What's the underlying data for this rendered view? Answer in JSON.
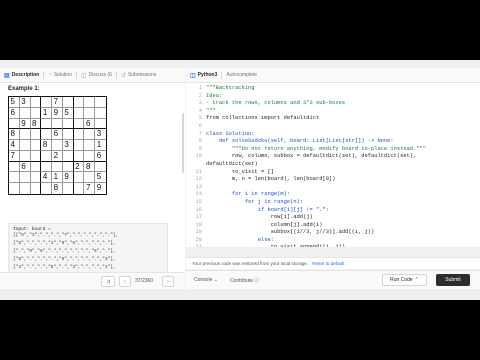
{
  "left_tabs": [
    {
      "icon": "▤",
      "label": "Description",
      "active": true
    },
    {
      "icon": "◔",
      "label": "Solution",
      "active": false
    },
    {
      "icon": "◫",
      "label": "Discuss (6",
      "active": false
    },
    {
      "icon": "↺",
      "label": "Submissions",
      "active": false
    }
  ],
  "right_tabs": [
    {
      "icon": "◫",
      "label": "Python3",
      "active": true
    },
    {
      "icon": "",
      "label": "Autocomplete",
      "active": false
    }
  ],
  "example_title": "Example 1:",
  "board": [
    [
      "5",
      "3",
      "",
      "",
      "7",
      "",
      "",
      "",
      ""
    ],
    [
      "6",
      "",
      "",
      "1",
      "9",
      "5",
      "",
      "",
      ""
    ],
    [
      "",
      "9",
      "8",
      "",
      "",
      "",
      "",
      "6",
      ""
    ],
    [
      "8",
      "",
      "",
      "",
      "6",
      "",
      "",
      "",
      "3"
    ],
    [
      "4",
      "",
      "",
      "8",
      "",
      "3",
      "",
      "",
      "1"
    ],
    [
      "7",
      "",
      "",
      "",
      "2",
      "",
      "",
      "",
      "6"
    ],
    [
      "",
      "6",
      "",
      "",
      "",
      "",
      "2",
      "8",
      ""
    ],
    [
      "",
      "",
      "",
      "4",
      "1",
      "9",
      "",
      "",
      "5"
    ],
    [
      "",
      "",
      "",
      "",
      "8",
      "",
      "",
      "7",
      "9"
    ]
  ],
  "input_label": "Input: board =",
  "input_lines": [
    "[[\"5\",\"3\",\".\",\".\",\"7\",\".\",\".\",\".\",\".\"],",
    "[\"6\",\".\",\".\",\"1\",\"9\",\"5\",\".\",\".\",\".\"],",
    "[\".\",\"9\",\"8\",\".\",\".\",\".\",\".\",\"6\",\".\"],",
    "[\"8\",\".\",\".\",\".\",\"6\",\".\",\".\",\".\",\"3\"],",
    "[\"4\",\".\",\".\",\"8\",\".\",\"3\",\".\",\".\",\"1\"],",
    "[\"7\",\".\",\".\",\".\",\"2\",\".\",\".\",\".\",\"6\"],",
    "[\".\",\"6\",\".\",\".\",\".\",\".\",\"2\",\"8\",\".\"],"
  ],
  "bottom_left": {
    "shuffle_icon": "⤨",
    "prev_icon": "‹",
    "pager": "37/2360",
    "next_icon": "›"
  },
  "code_lines": [
    {
      "n": "1",
      "t": "\"\"\"Backtracking",
      "c": "cm"
    },
    {
      "n": "2",
      "t": "Idea:",
      "c": "cm"
    },
    {
      "n": "3",
      "t": "- track the rows, columns and 3*3 sub-boxes",
      "c": "cm"
    },
    {
      "n": "4",
      "t": "\"\"\"",
      "c": "cm"
    },
    {
      "n": "5",
      "t": "from collections import defaultdict",
      "c": ""
    },
    {
      "n": "6",
      "t": "",
      "c": ""
    },
    {
      "n": "7",
      "t": "class Solution:",
      "c": "kw"
    },
    {
      "n": "8",
      "t": "    def solveSudoku(self, board: List[List[str]]) -> None:",
      "c": "kw"
    },
    {
      "n": "9",
      "t": "        \"\"\"Do not return anything, modify board in-place instead.\"\"\"",
      "c": "cm"
    },
    {
      "n": "10",
      "t": "        row, column, subbox = defaultdict(set), defaultdict(set),",
      "c": ""
    },
    {
      "n": "",
      "t": "defaultdict(set)",
      "c": ""
    },
    {
      "n": "11",
      "t": "        to_visit = []",
      "c": ""
    },
    {
      "n": "12",
      "t": "        m, n = len(board), len(board[0])",
      "c": ""
    },
    {
      "n": "13",
      "t": "",
      "c": ""
    },
    {
      "n": "14",
      "t": "        for i in range(m):",
      "c": "kw"
    },
    {
      "n": "15",
      "t": "            for j in range(n):",
      "c": "kw"
    },
    {
      "n": "16",
      "t": "                if board[i][j] != \".\":",
      "c": "kw"
    },
    {
      "n": "17",
      "t": "                    row[i].add(j)",
      "c": ""
    },
    {
      "n": "18",
      "t": "                    column[j].add(i)",
      "c": ""
    },
    {
      "n": "19",
      "t": "                    subbox[(i//3, j//3)].add((i, j))",
      "c": ""
    },
    {
      "n": "20",
      "t": "                else:",
      "c": "kw"
    },
    {
      "n": "21",
      "t": "                    to_visit.append((i, j))",
      "c": ""
    },
    {
      "n": "22",
      "t": "",
      "c": "cursor"
    }
  ],
  "notice": {
    "text": "Your previous code was restored from your local storage.",
    "link": "Reset to default"
  },
  "bottom_right": {
    "console_label": "Console",
    "contribute_label": "Contribute",
    "run_label": "Run Code",
    "run_icon": "⌃",
    "submit_label": "Submit"
  }
}
